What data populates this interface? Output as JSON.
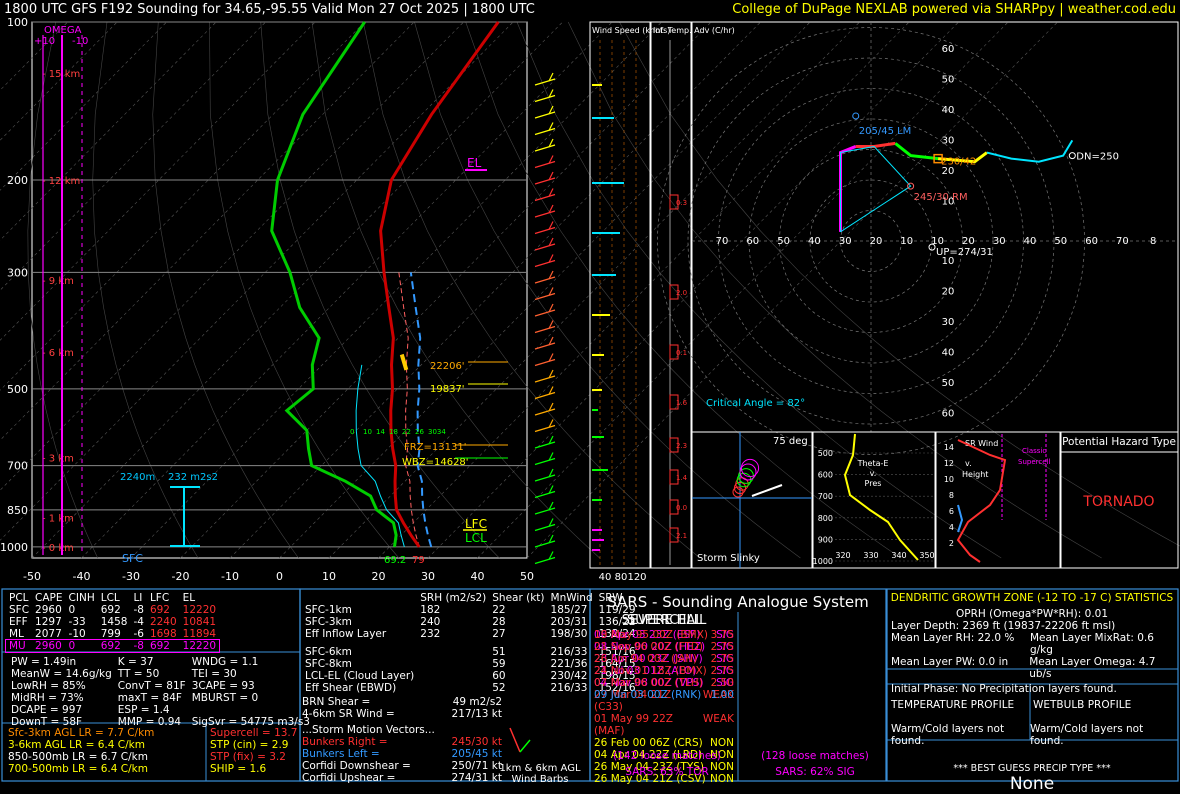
{
  "header": {
    "left": "1800 UTC GFS F192 Sounding for 34.65,-95.55 Valid  Mon 27 Oct 2025 | 1800 UTC",
    "right": "College of DuPage NEXLAB powered via SHARPpy | weather.cod.edu"
  },
  "skewt": {
    "pressure_ticks": [
      "100",
      "200",
      "300",
      "500",
      "700",
      "850",
      "1000"
    ],
    "temp_ticks": [
      "-50",
      "-40",
      "-30",
      "-20",
      "-10",
      "0",
      "10",
      "20",
      "30",
      "40",
      "50"
    ],
    "km_labels": [
      "15 km",
      "12 km",
      "9 km",
      "6 km",
      "3 km",
      "1 km",
      "0 km"
    ],
    "omega_label": "OMEGA",
    "omega_scale": [
      "+10",
      "-10"
    ],
    "el_label": "EL",
    "lfc_label": "LFC",
    "lcl_label": "LCL",
    "sfc_label": "SFC",
    "frz": "FRZ=13131'",
    "wbz": "WBZ=14628'",
    "dgz_top": "22206'",
    "dgz_bot": "19837'",
    "effective_layer_depth": "2240m",
    "effective_srh": "232 m2s2",
    "sfc_temp": "79",
    "sfc_dew": "69.2",
    "hodo_km_marks": [
      "0",
      "10",
      "14",
      "18",
      "22",
      "26",
      "3034"
    ]
  },
  "wind_speed_panel": {
    "title": "Wind Speed (knots)",
    "ticks": [
      "40",
      "80",
      "120"
    ]
  },
  "temp_adv_panel": {
    "title": "Inf. Temp. Adv (C/hr)",
    "values": [
      "0.3",
      "2.0",
      "0.1",
      "1.6",
      "2.3",
      "1.4",
      "0.0",
      "2.1"
    ]
  },
  "hodograph": {
    "rings": [
      "10",
      "20",
      "30",
      "40",
      "50",
      "60",
      "70"
    ],
    "x_axis_labels": [
      "70",
      "60",
      "50",
      "40",
      "30",
      "20",
      "10",
      "10",
      "20",
      "30",
      "40",
      "50",
      "60",
      "70",
      "8"
    ],
    "y_axis_labels_top": [
      "60",
      "50",
      "40",
      "30",
      "20",
      "10"
    ],
    "y_axis_labels_bottom": [
      "10",
      "20",
      "30",
      "40",
      "50",
      "60"
    ],
    "lm": "205/45 LM",
    "rm": "245/30 RM",
    "mean": "230/42",
    "dn": "DN=250",
    "up": "UP=274/31",
    "critical_angle": "Critical Angle = 82°"
  },
  "storm_slinky": {
    "label": "Storm Slinky",
    "angle": "75 deg"
  },
  "theta_e": {
    "label": "Theta-E v. Pres",
    "y_ticks": [
      "500",
      "600",
      "700",
      "800",
      "900",
      "1000"
    ],
    "x_ticks": [
      "320",
      "330",
      "340",
      "350"
    ]
  },
  "srwind": {
    "label": "SR Wind v. Height",
    "classic": "Classic Supercell",
    "y_ticks": [
      "14",
      "12",
      "10",
      "8",
      "6",
      "4",
      "2"
    ]
  },
  "hazard": {
    "title": "Potential Hazard Type",
    "value": "TORNADO"
  },
  "parcels": {
    "headers": [
      "PCL",
      "CAPE",
      "CINH",
      "LCL",
      "LI",
      "LFC",
      "EL"
    ],
    "rows": [
      {
        "pcl": "SFC",
        "cape": "2960",
        "cinh": "0",
        "lcl": "692",
        "li": "-8",
        "lfc": "692",
        "el": "12220"
      },
      {
        "pcl": "EFF",
        "cape": "1297",
        "cinh": "-33",
        "lcl": "1458",
        "li": "-4",
        "lfc": "2240",
        "el": "10841"
      },
      {
        "pcl": "ML",
        "cape": "2077",
        "cinh": "-10",
        "lcl": "799",
        "li": "-6",
        "lfc": "1698",
        "el": "11894"
      },
      {
        "pcl": "MU",
        "cape": "2960",
        "cinh": "0",
        "lcl": "692",
        "li": "-8",
        "lfc": "692",
        "el": "12220"
      }
    ]
  },
  "indices": [
    [
      "PW = 1.49in",
      "K = 37",
      "WNDG = 1.1"
    ],
    [
      "MeanW = 14.6g/kg",
      "TT = 50",
      "TEI = 30"
    ],
    [
      "LowRH = 85%",
      "ConvT = 81F",
      "3CAPE = 93"
    ],
    [
      "MidRH = 73%",
      "maxT = 84F",
      "MBURST = 0"
    ],
    [
      "DCAPE = 997",
      "ESP = 1.4",
      ""
    ],
    [
      "DownT = 58F",
      "MMP = 0.94",
      "SigSvr = 54775 m3/s3"
    ]
  ],
  "lapse": [
    {
      "label": "Sfc-3km AGL LR = 7.7 C/km",
      "color": "#ff8c00"
    },
    {
      "label": "3-6km AGL LR = 6.4 C/km",
      "color": "#ffff00"
    },
    {
      "label": "850-500mb LR = 6.7 C/km",
      "color": "#ffffff"
    },
    {
      "label": "700-500mb LR = 6.4 C/km",
      "color": "#ffff00"
    }
  ],
  "composite": [
    {
      "label": "Supercell = 13.7",
      "color": "#ff3030"
    },
    {
      "label": "STP (cin) = 2.9",
      "color": "#ffff00"
    },
    {
      "label": "STP (fix) = 3.2",
      "color": "#ff3030"
    },
    {
      "label": "SHIP = 1.6",
      "color": "#ffff00"
    }
  ],
  "kinematics": {
    "headers": [
      "SRH (m2/s2)",
      "Shear (kt)",
      "MnWind",
      "SRW"
    ],
    "rows": [
      {
        "name": "SFC-1km",
        "srh": "182",
        "shear": "22",
        "mn": "185/27",
        "srw": "119/29",
        "color": "#fff"
      },
      {
        "name": "SFC-3km",
        "srh": "240",
        "shear": "28",
        "mn": "203/31",
        "srw": "136/22",
        "color": "#fff"
      },
      {
        "name": "Eff Inflow Layer",
        "srh": "232",
        "shear": "27",
        "mn": "198/30",
        "srw": "132/24",
        "color": "#fff"
      },
      {
        "name": "",
        "srh": "",
        "shear": "",
        "mn": "",
        "srw": "",
        "color": "#fff"
      },
      {
        "name": "SFC-6km",
        "srh": "",
        "shear": "51",
        "mn": "216/33",
        "srw": "151/16",
        "color": "#fff"
      },
      {
        "name": "SFC-8km",
        "srh": "",
        "shear": "59",
        "mn": "221/36",
        "srw": "164/15",
        "color": "#fff"
      },
      {
        "name": "LCL-EL (Cloud Layer)",
        "srh": "",
        "shear": "60",
        "mn": "230/42",
        "srw": "198/15",
        "color": "#fff"
      },
      {
        "name": "Eff Shear (EBWD)",
        "srh": "",
        "shear": "52",
        "mn": "216/33",
        "srw": "152/16",
        "color": "#fff"
      }
    ],
    "brn": "BRN Shear =",
    "brn_val": "49 m2/s2",
    "srwind": "4-6km SR Wind =",
    "srwind_val": "217/13 kt",
    "storm_motion_title": "...Storm Motion Vectors...",
    "storm_motion": [
      {
        "label": "Bunkers Right =",
        "val": "245/30 kt",
        "color": "#ff3030"
      },
      {
        "label": "Bunkers Left =",
        "val": "205/45 kt",
        "color": "#3399ff"
      },
      {
        "label": "Corfidi Downshear =",
        "val": "250/71 kt",
        "color": "#fff"
      },
      {
        "label": "Corfidi Upshear =",
        "val": "274/31 kt",
        "color": "#fff"
      }
    ],
    "barbs_label": "1km & 6km AGL Wind Barbs"
  },
  "sars": {
    "title": "SARS - Sounding Analogue System",
    "supercell_title": "SUPERCELL",
    "hail_title": "SEVERE HAIL",
    "supercell": [
      {
        "t": "06 Apr 03 23Z (ESF)",
        "v": "SIG",
        "c": "#ff00ff"
      },
      {
        "t": "08 Nov 00 20Z (HEZ)",
        "v": "SIG",
        "c": "#ff00ff"
      },
      {
        "t": "23 Apr 00 23Z (SHV)",
        "v": "SIG",
        "c": "#ff00ff"
      },
      {
        "t": "21 Jul 03 01Z (ALO)",
        "v": "SIG",
        "c": "#ff00ff"
      },
      {
        "t": "04 Nov 08 00Z (VPS)",
        "v": "SIG",
        "c": "#ff00ff"
      },
      {
        "t": "27 Mar 04 21Z (C33)",
        "v": "WEAK",
        "c": "#ff3030"
      },
      {
        "t": "01 May 99 22Z (MAF)",
        "v": "WEAK",
        "c": "#ff3030"
      },
      {
        "t": "26 Feb 00 06Z (CRS)",
        "v": "NON",
        "c": "#ffff00"
      },
      {
        "t": "04 Apr 04 22Z (LRD)",
        "v": "NON",
        "c": "#ffff00"
      },
      {
        "t": "26 May 04 23Z (TYS)",
        "v": "NON",
        "c": "#ffff00"
      },
      {
        "t": "26 May 04 21Z (CSV)",
        "v": "NON",
        "c": "#ffff00"
      }
    ],
    "hail": [
      {
        "t": "19 May 95 00Z (BMX)",
        "v": "3.75",
        "c": "#ff3030"
      },
      {
        "t": "21 Sep 96 00Z (FTD)",
        "v": "2.75",
        "c": "#ff3030"
      },
      {
        "t": "26 Jun 94 00Z (JAN)",
        "v": "2.75",
        "c": "#ff3030"
      },
      {
        "t": "24 Nov 01 18Z (BMX)",
        "v": "2.75",
        "c": "#ff3030"
      },
      {
        "t": "07 Mar 96 00Z (TLH)",
        "v": "2.50",
        "c": "#ff3030"
      },
      {
        "t": "09 Jun 03 00Z (RNK)",
        "v": "1.00",
        "c": "#3399ff"
      }
    ],
    "supercell_matches": "(142 loose matches)",
    "hail_matches": "(128 loose matches)",
    "sc_prob": "SARS: 63% TOR",
    "hail_prob": "SARS: 62% SIG"
  },
  "dgz": {
    "title": "DENDRITIC GROWTH ZONE (-12 TO -17 C) STATISTICS",
    "oprh": "OPRH (Omega*PW*RH): 0.01",
    "depth": "Layer Depth: 2369 ft (19837-22206 ft msl)",
    "rh": "Mean Layer RH: 22.0 %",
    "mixrat": "Mean Layer MixRat: 0.6 g/kg",
    "pw": "Mean Layer PW: 0.0 in",
    "omega": "Mean Layer Omega: 4.7 ub/s",
    "phase": "Initial Phase:  No Precipitation layers found.",
    "temp_profile_title": "TEMPERATURE PROFILE",
    "wb_profile_title": "WETBULB PROFILE",
    "temp_profile": "Warm/Cold layers not found.",
    "wb_profile": "Warm/Cold layers not found.",
    "precip_title": "*** BEST GUESS PRECIP TYPE ***",
    "precip": "None"
  },
  "colors": {
    "temp": "#ff0000",
    "dew": "#00cc00",
    "wetbulb": "#00e5ff",
    "parcel": "#ff3333",
    "virtual": "#3399ff",
    "accent": "#3a8fd8"
  }
}
